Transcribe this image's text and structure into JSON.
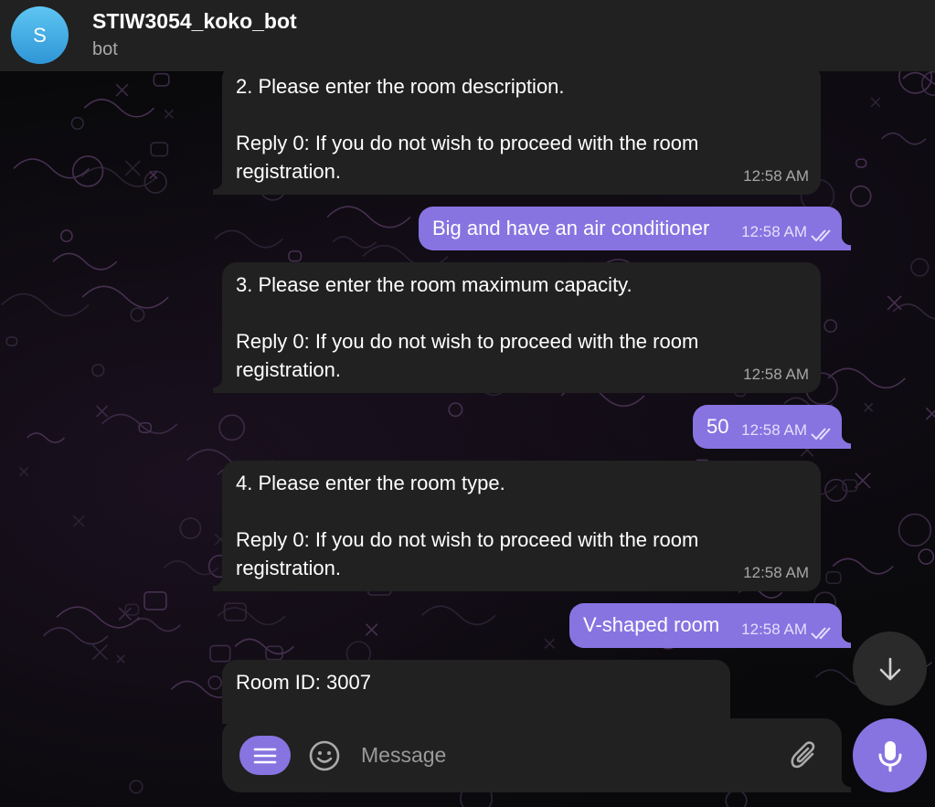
{
  "header": {
    "avatar_letter": "S",
    "title": "STIW3054_koko_bot",
    "subtitle": "bot"
  },
  "messages": [
    {
      "direction": "in",
      "text": "2. Please enter the room description.\n\nReply 0: If you do not wish to proceed with the room registration.",
      "time": "12:58 AM"
    },
    {
      "direction": "out",
      "text": "Big and have an air conditioner",
      "time": "12:58 AM",
      "status": "read"
    },
    {
      "direction": "in",
      "text": "3. Please enter the room maximum capacity.\n\nReply 0: If you do not wish to proceed with the room registration.",
      "time": "12:58 AM"
    },
    {
      "direction": "out",
      "text": "50",
      "time": "12:58 AM",
      "status": "read"
    },
    {
      "direction": "in",
      "text": "4. Please enter the room type.\n\nReply 0: If you do not wish to proceed with the room registration.",
      "time": "12:58 AM"
    },
    {
      "direction": "out",
      "text": "V-shaped room",
      "time": "12:58 AM",
      "status": "read"
    },
    {
      "direction": "in",
      "text": "Room ID: 3007",
      "time": ""
    }
  ],
  "composer": {
    "placeholder": "Message",
    "value": ""
  },
  "icons": {
    "menu": "menu-icon",
    "emoji": "emoji-icon",
    "attach": "paperclip-icon",
    "mic": "microphone-icon",
    "scroll_down": "arrow-down-icon",
    "read_status": "double-check-icon"
  },
  "colors": {
    "accent": "#8774e1",
    "incoming_bubble": "#212121",
    "header_bg": "#212121",
    "avatar": "#3ea6e2"
  }
}
